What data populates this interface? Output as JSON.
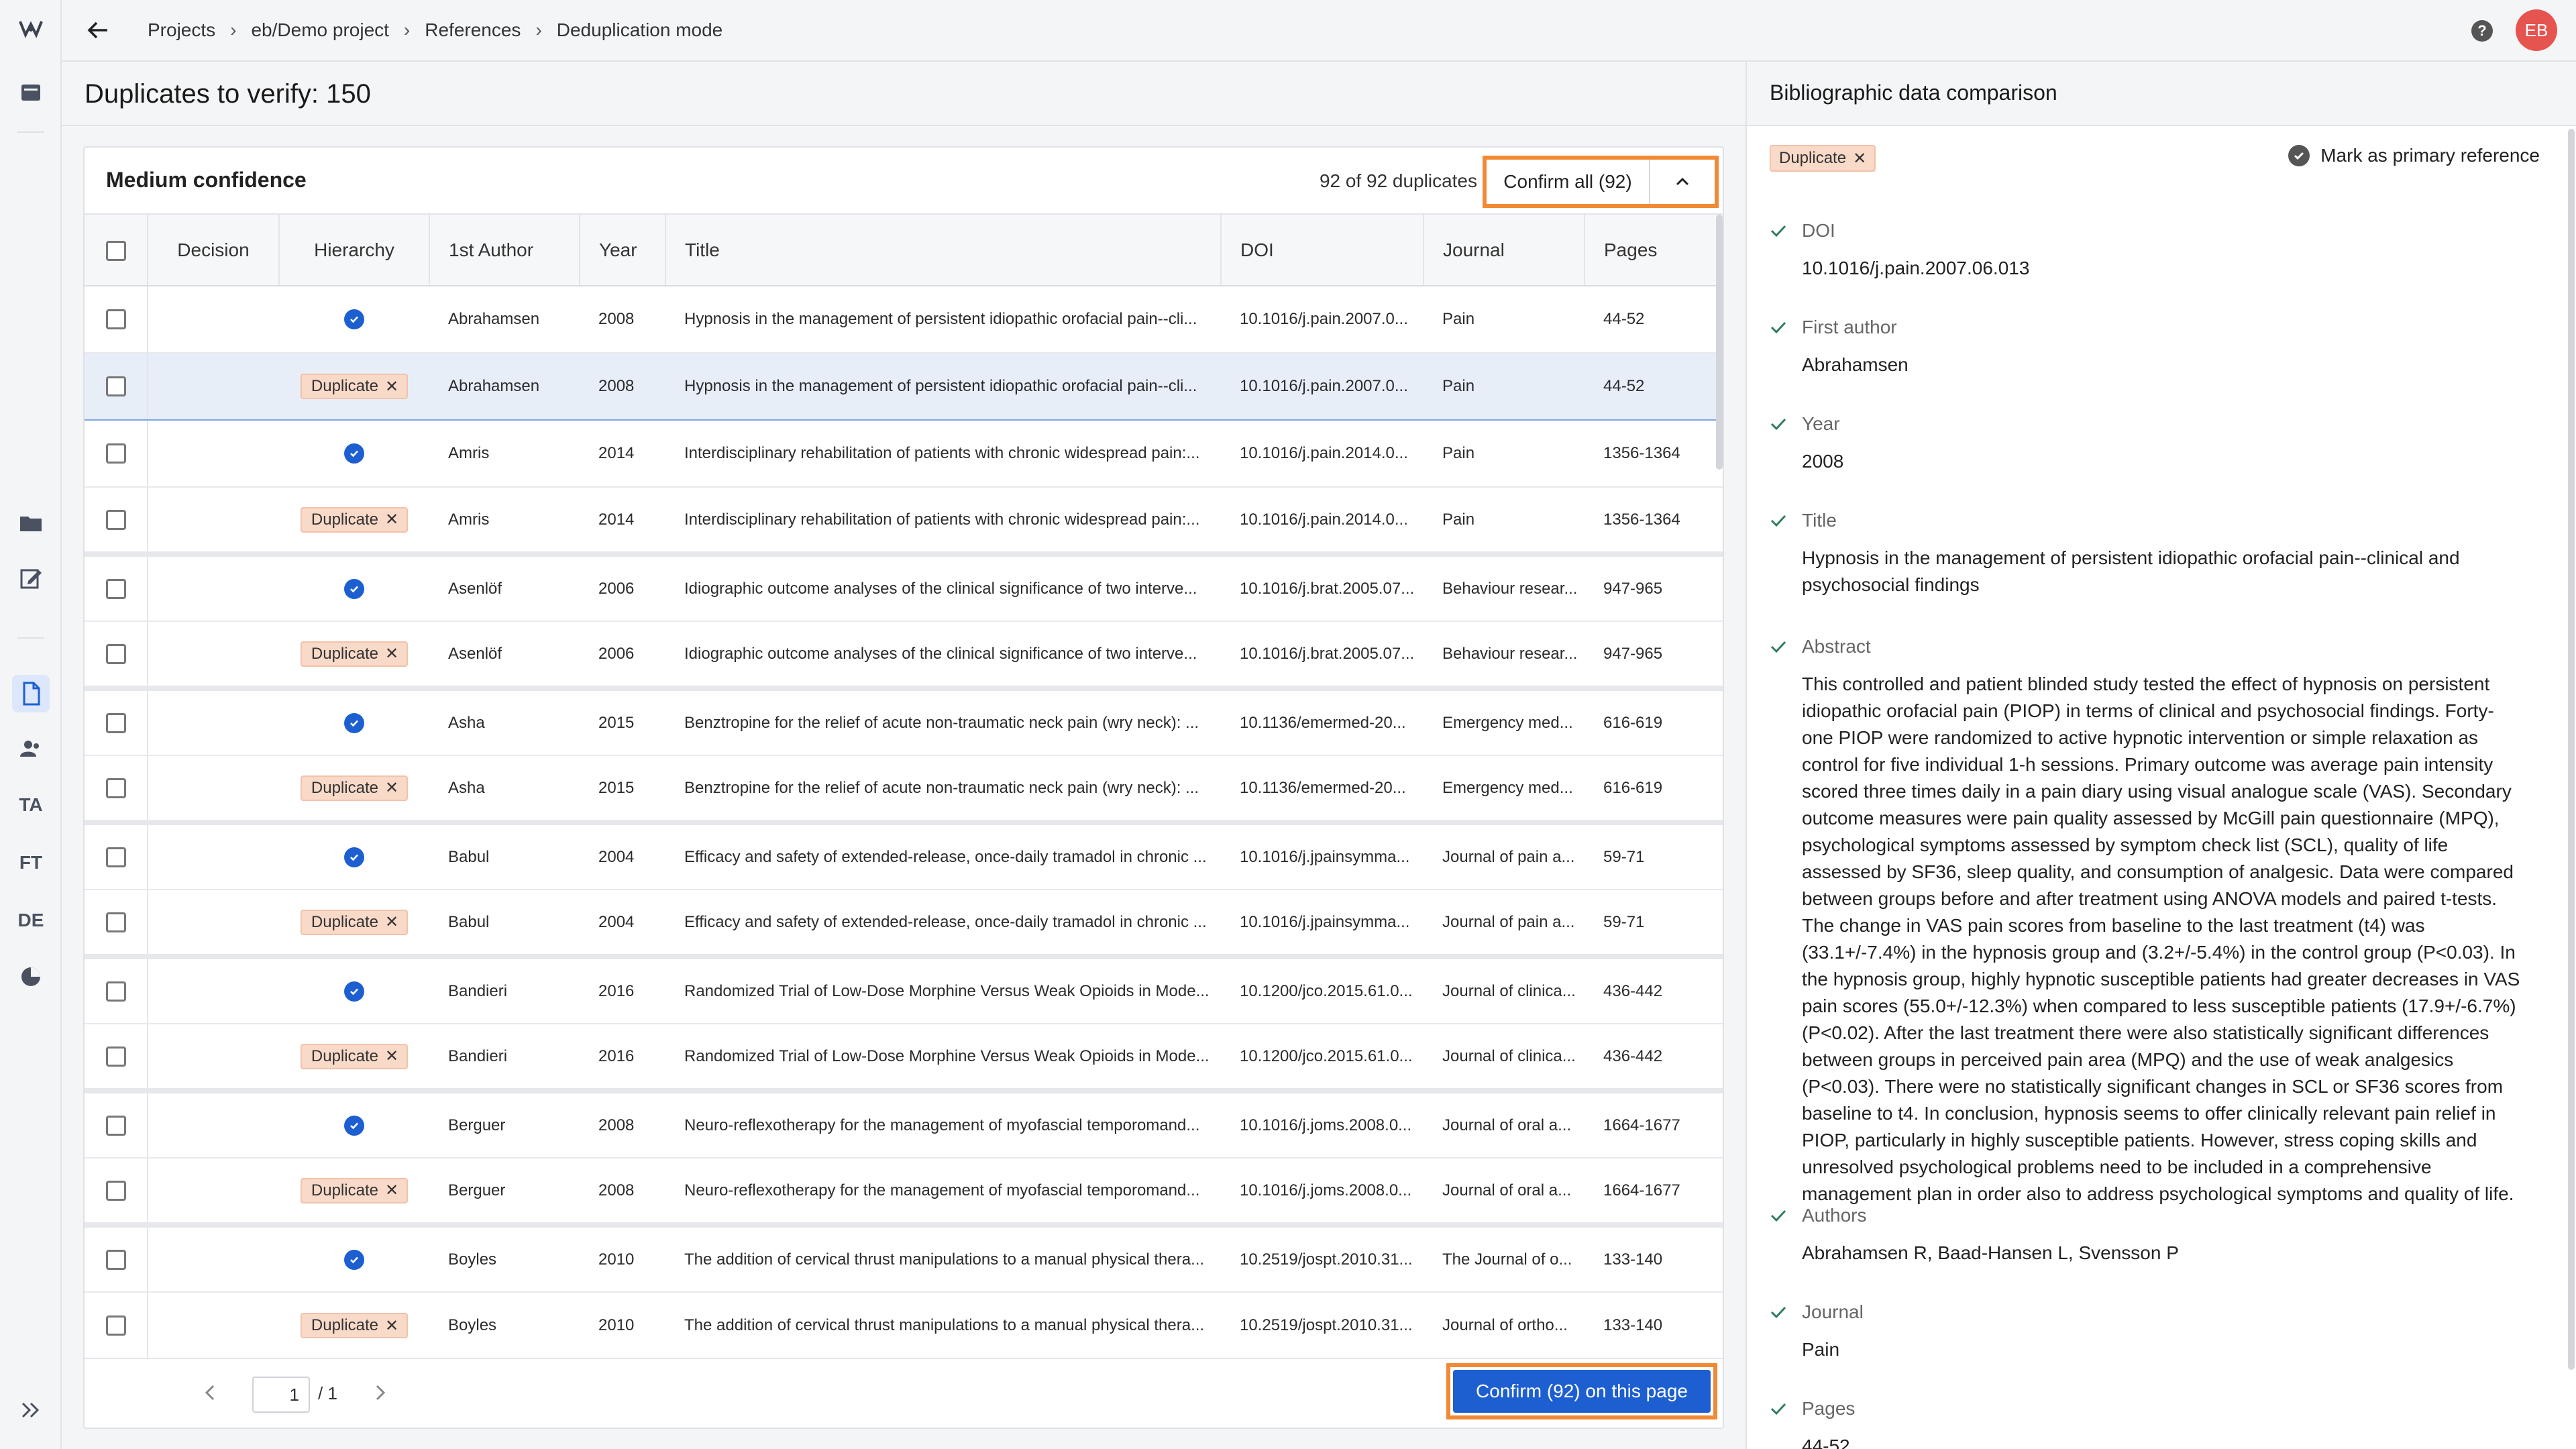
{
  "topbar": {
    "breadcrumbs": [
      "Projects",
      "eb/Demo project",
      "References",
      "Deduplication mode"
    ],
    "avatar_initials": "EB"
  },
  "rail": {
    "items": [
      {
        "name": "logo",
        "label": ""
      },
      {
        "name": "inbox-icon",
        "label": ""
      },
      {
        "name": "folder-icon",
        "label": ""
      },
      {
        "name": "edit-icon",
        "label": ""
      },
      {
        "name": "document-icon",
        "label": ""
      },
      {
        "name": "users-icon",
        "label": ""
      },
      {
        "name": "ta",
        "label": "TA"
      },
      {
        "name": "ft",
        "label": "FT"
      },
      {
        "name": "de",
        "label": "DE"
      },
      {
        "name": "analysis-icon",
        "label": ""
      }
    ]
  },
  "main": {
    "title": "Duplicates to verify: 150",
    "card_title": "Medium confidence",
    "dup_count": "92 of 92 duplicates",
    "confirm_all": "Confirm all (92)",
    "columns": [
      "Decision",
      "Hierarchy",
      "1st Author",
      "Year",
      "Title",
      "DOI",
      "Journal",
      "Pages"
    ],
    "rows": [
      {
        "hier": "primary",
        "author": "Abrahamsen",
        "year": "2008",
        "title": "Hypnosis in the management of persistent idiopathic orofacial pain--cli...",
        "doi": "10.1016/j.pain.2007.0...",
        "journal": "Pain",
        "pages": "44-52"
      },
      {
        "hier": "Duplicate",
        "author": "Abrahamsen",
        "year": "2008",
        "title": "Hypnosis in the management of persistent idiopathic orofacial pain--cli...",
        "doi": "10.1016/j.pain.2007.0...",
        "journal": "Pain",
        "pages": "44-52"
      },
      {
        "hier": "primary",
        "author": "Amris",
        "year": "2014",
        "title": "Interdisciplinary rehabilitation of patients with chronic widespread pain:...",
        "doi": "10.1016/j.pain.2014.0...",
        "journal": "Pain",
        "pages": "1356-1364"
      },
      {
        "hier": "Duplicate",
        "author": "Amris",
        "year": "2014",
        "title": "Interdisciplinary rehabilitation of patients with chronic widespread pain:...",
        "doi": "10.1016/j.pain.2014.0...",
        "journal": "Pain",
        "pages": "1356-1364"
      },
      {
        "hier": "primary",
        "author": "Asenlöf",
        "year": "2006",
        "title": "Idiographic outcome analyses of the clinical significance of two interve...",
        "doi": "10.1016/j.brat.2005.07...",
        "journal": "Behaviour resear...",
        "pages": "947-965"
      },
      {
        "hier": "Duplicate",
        "author": "Asenlöf",
        "year": "2006",
        "title": "Idiographic outcome analyses of the clinical significance of two interve...",
        "doi": "10.1016/j.brat.2005.07...",
        "journal": "Behaviour resear...",
        "pages": "947-965"
      },
      {
        "hier": "primary",
        "author": "Asha",
        "year": "2015",
        "title": "Benztropine for the relief of acute non-traumatic neck pain (wry neck): ...",
        "doi": "10.1136/emermed-20...",
        "journal": "Emergency med...",
        "pages": "616-619"
      },
      {
        "hier": "Duplicate",
        "author": "Asha",
        "year": "2015",
        "title": "Benztropine for the relief of acute non-traumatic neck pain (wry neck): ...",
        "doi": "10.1136/emermed-20...",
        "journal": "Emergency med...",
        "pages": "616-619"
      },
      {
        "hier": "primary",
        "author": "Babul",
        "year": "2004",
        "title": "Efficacy and safety of extended-release, once-daily tramadol in chronic ...",
        "doi": "10.1016/j.jpainsymma...",
        "journal": "Journal of pain a...",
        "pages": "59-71"
      },
      {
        "hier": "Duplicate",
        "author": "Babul",
        "year": "2004",
        "title": "Efficacy and safety of extended-release, once-daily tramadol in chronic ...",
        "doi": "10.1016/j.jpainsymma...",
        "journal": "Journal of pain a...",
        "pages": "59-71"
      },
      {
        "hier": "primary",
        "author": "Bandieri",
        "year": "2016",
        "title": "Randomized Trial of Low-Dose Morphine Versus Weak Opioids in Mode...",
        "doi": "10.1200/jco.2015.61.0...",
        "journal": "Journal of clinica...",
        "pages": "436-442"
      },
      {
        "hier": "Duplicate",
        "author": "Bandieri",
        "year": "2016",
        "title": "Randomized Trial of Low-Dose Morphine Versus Weak Opioids in Mode...",
        "doi": "10.1200/jco.2015.61.0...",
        "journal": "Journal of clinica...",
        "pages": "436-442"
      },
      {
        "hier": "primary",
        "author": "Berguer",
        "year": "2008",
        "title": "Neuro-reflexotherapy for the management of myofascial temporomand...",
        "doi": "10.1016/j.joms.2008.0...",
        "journal": "Journal of oral a...",
        "pages": "1664-1677"
      },
      {
        "hier": "Duplicate",
        "author": "Berguer",
        "year": "2008",
        "title": "Neuro-reflexotherapy for the management of myofascial temporomand...",
        "doi": "10.1016/j.joms.2008.0...",
        "journal": "Journal of oral a...",
        "pages": "1664-1677"
      },
      {
        "hier": "primary",
        "author": "Boyles",
        "year": "2010",
        "title": "The addition of cervical thrust manipulations to a manual physical thera...",
        "doi": "10.2519/jospt.2010.31...",
        "journal": "The Journal of o...",
        "pages": "133-140"
      },
      {
        "hier": "Duplicate",
        "author": "Boyles",
        "year": "2010",
        "title": "The addition of cervical thrust manipulations to a manual physical thera...",
        "doi": "10.2519/jospt.2010.31...",
        "journal": "Journal of ortho...",
        "pages": "133-140"
      }
    ],
    "pager": {
      "page": "1",
      "total": "/ 1"
    },
    "confirm_page": "Confirm (92) on this page"
  },
  "panel": {
    "title": "Bibliographic data comparison",
    "tag": "Duplicate",
    "mark_primary": "Mark as primary reference",
    "fields": [
      {
        "label": "DOI",
        "value": "10.1016/j.pain.2007.06.013"
      },
      {
        "label": "First author",
        "value": "Abrahamsen"
      },
      {
        "label": "Year",
        "value": "2008"
      },
      {
        "label": "Title",
        "value": "Hypnosis in the management of persistent idiopathic orofacial pain--clinical and psychosocial findings"
      },
      {
        "label": "Abstract",
        "value": "This controlled and patient blinded study tested the effect of hypnosis on persistent idiopathic orofacial pain (PIOP) in terms of clinical and psychosocial findings. Forty-one PIOP were randomized to active hypnotic intervention or simple relaxation as control for five individual 1-h sessions. Primary outcome was average pain intensity scored three times daily in a pain diary using visual analogue scale (VAS). Secondary outcome measures were pain quality assessed by McGill pain questionnaire (MPQ), psychological symptoms assessed by symptom check list (SCL), quality of life assessed by SF36, sleep quality, and consumption of analgesic. Data were compared between groups before and after treatment using ANOVA models and paired t-tests. The change in VAS pain scores from baseline to the last treatment (t4) was (33.1+/-7.4%) in the hypnosis group and (3.2+/-5.4%) in the control group (P<0.03). In the hypnosis group, highly hypnotic susceptible patients had greater decreases in VAS pain scores (55.0+/-12.3%) when compared to less susceptible patients (17.9+/-6.7%) (P<0.02). After the last treatment there were also statistically significant differences between groups in perceived pain area (MPQ) and the use of weak analgesics (P<0.03). There were no statistically significant changes in SCL or SF36 scores from baseline to t4. In conclusion, hypnosis seems to offer clinically relevant pain relief in PIOP, particularly in highly susceptible patients. However, stress coping skills and unresolved psychological problems need to be included in a comprehensive management plan in order also to address psychological symptoms and quality of life."
      },
      {
        "label": "Authors",
        "value": "Abrahamsen R, Baad-Hansen L, Svensson P"
      },
      {
        "label": "Journal",
        "value": "Pain"
      },
      {
        "label": "Pages",
        "value": "44-52"
      }
    ]
  },
  "colors": {
    "accent": "#1d5fd1",
    "highlight": "#f28a35",
    "duplicate_bg": "#f9d9c8",
    "avatar": "#e5544f"
  }
}
